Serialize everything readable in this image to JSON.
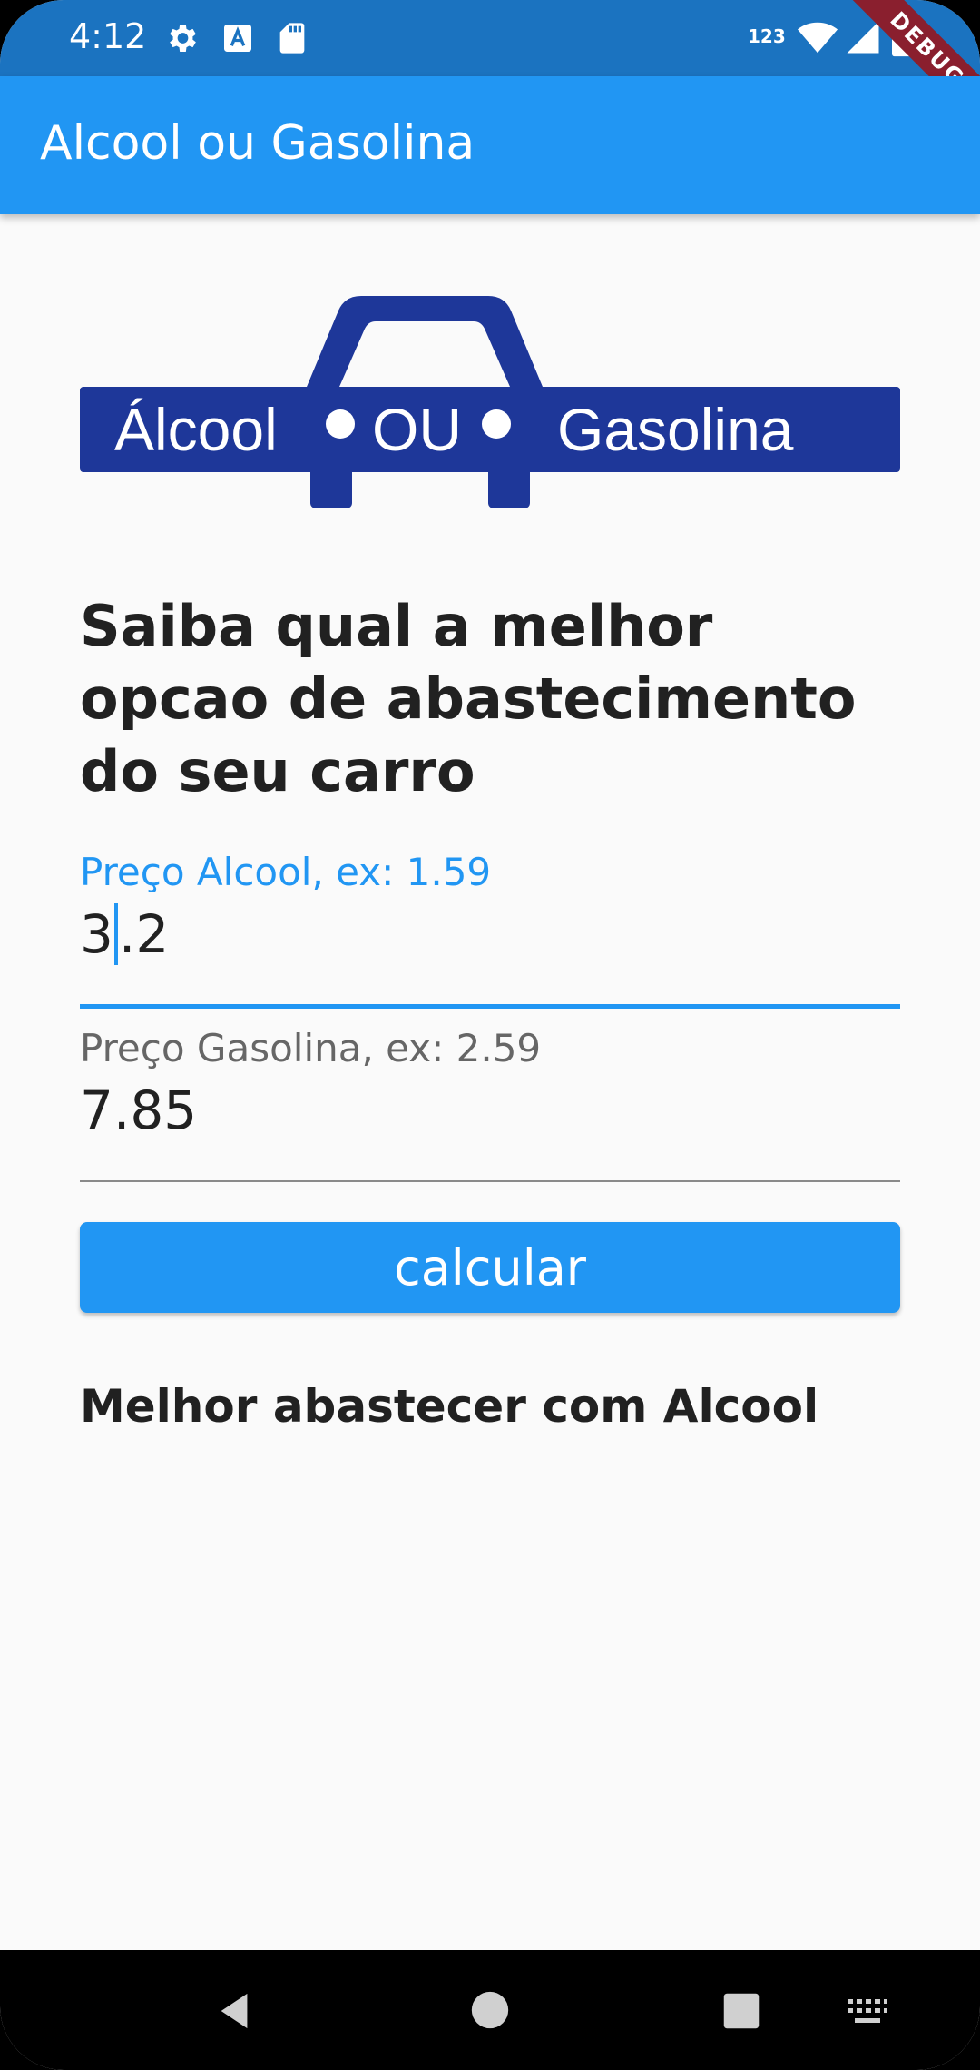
{
  "status_bar": {
    "time": "4:12",
    "network_label": "123",
    "icons": [
      "gear-icon",
      "font-icon",
      "sd-card-icon",
      "wifi-icon",
      "signal-icon",
      "battery-icon"
    ]
  },
  "debug_banner": "DEBUG",
  "app_bar": {
    "title": "Alcool ou Gasolina"
  },
  "logo": {
    "text_left": "Álcool",
    "text_middle": "OU",
    "text_right": "Gasolina"
  },
  "main": {
    "headline": "Saiba qual a melhor opcao de abastecimento do seu carro",
    "fields": [
      {
        "label": "Preço Alcool, ex: 1.59",
        "value_before_caret": "3",
        "value_after_caret": ".2",
        "focused": true
      },
      {
        "label": "Preço Gasolina, ex: 2.59",
        "value": "7.85",
        "focused": false
      }
    ],
    "button_label": "calcular",
    "result": "Melhor abastecer com Alcool"
  },
  "nav_bar": {
    "icons": [
      "back-icon",
      "home-icon",
      "recents-icon",
      "keyboard-icon"
    ]
  },
  "colors": {
    "primary": "#2196f3",
    "status_bar": "#1b73c0",
    "logo_blue": "#1e3799",
    "debug": "#8a1f2e"
  }
}
